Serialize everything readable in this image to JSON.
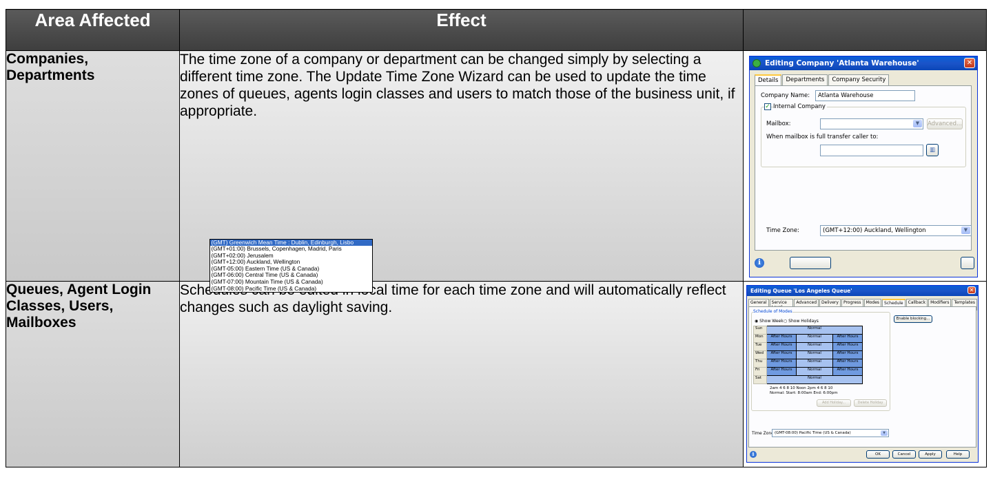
{
  "table": {
    "headers": [
      "Area Affected",
      "Effect",
      ""
    ],
    "rows": [
      {
        "area": "Companies, Departments",
        "effect": "The time zone of a company or department can be changed simply by selecting a different time zone. The Update Time Zone Wizard can be used to update the time zones of queues, agents login classes and users to match those of the business unit, if appropriate."
      },
      {
        "area": "Queues, Agent Login Classes, Users, Mailboxes",
        "effect": "Schedules can be edited in local time for each time zone and will automatically reflect changes such as daylight saving."
      }
    ]
  },
  "dialog1": {
    "title": "Editing Company 'Atlanta Warehouse'",
    "tabs": [
      "Details",
      "Departments",
      "Company Security"
    ],
    "company_name_label": "Company Name:",
    "company_name_value": "Atlanta Warehouse",
    "internal_company_label": "Internal Company",
    "mailbox_label": "Mailbox:",
    "mailbox_value": "",
    "advanced_button": "Advanced...",
    "transfer_label": "When mailbox is full transfer caller to:",
    "time_zone_label": "Time Zone:",
    "time_zone_value": "(GMT+12:00) Auckland, Wellington",
    "time_zone_options": [
      "(GMT) Greenwich Mean Time : Dublin, Edinburgh, Lisbo",
      "(GMT+01:00) Brussels, Copenhagen, Madrid, Paris",
      "(GMT+02:00) Jerusalem",
      "(GMT+12:00) Auckland, Wellington",
      "(GMT-05:00) Eastern Time (US & Canada)",
      "(GMT-06:00) Central Time (US & Canada)",
      "(GMT-07:00) Mountain Time (US & Canada)",
      "(GMT-08:00) Pacific Time (US & Canada)"
    ]
  },
  "dialog2": {
    "title": "Editing Queue 'Los Angeles Queue'",
    "tabs": [
      "General",
      "Service Level",
      "Advanced",
      "Delivery",
      "Progress",
      "Modes",
      "Schedule",
      "Callback",
      "Modifiers",
      "Templates"
    ],
    "group_label": "Schedule of Modes",
    "show_week": "Show Week",
    "show_holidays": "Show Holidays",
    "enable_blocking": "Enable blocking...",
    "days": [
      "Sun",
      "Mon",
      "Tue",
      "Wed",
      "Thu",
      "Fri",
      "Sat"
    ],
    "after_hours": "After Hours",
    "normal": "Normal",
    "time_axis": "2am  4  6  8  10  Noon 2pm  4  6  8  10",
    "normal_info": "Normal: Start: 8:00am End: 6:00pm",
    "add_holiday": "Add Holiday...",
    "delete_holiday": "Delete Holiday",
    "time_zone_label": "Time Zone:",
    "time_zone_value": "(GMT-08:00) Pacific Time (US & Canada)",
    "ok": "OK",
    "cancel": "Cancel",
    "apply": "Apply",
    "help": "Help"
  }
}
